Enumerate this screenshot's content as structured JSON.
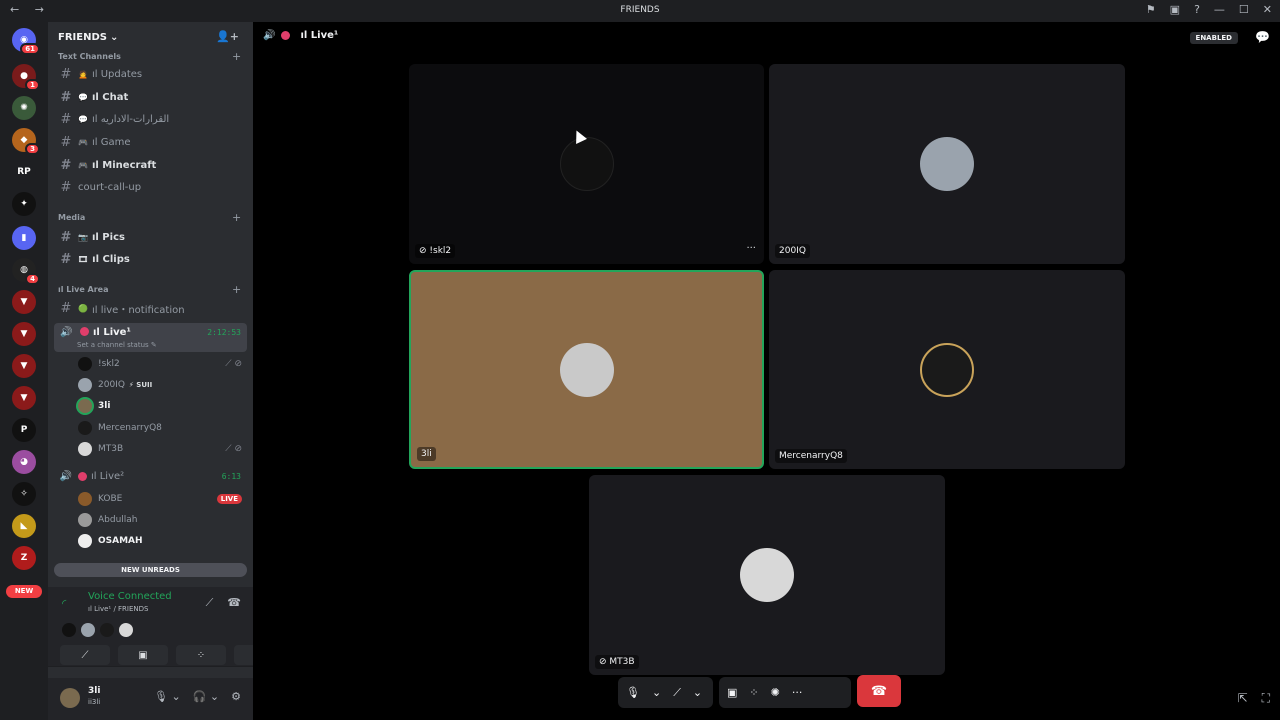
{
  "window": {
    "title": "FRIENDS",
    "nav": "← →",
    "icons": [
      "⚑",
      "▣",
      "?",
      "—",
      "☐",
      "✕"
    ]
  },
  "servers": [
    {
      "glyph": "◉",
      "badge": "61",
      "color": "#5865f2"
    },
    {
      "glyph": "●",
      "badge": "1",
      "color": "#7a1b1b"
    },
    {
      "glyph": "✺",
      "badge": "",
      "color": "#3a5a3a"
    },
    {
      "glyph": "◆",
      "badge": "3",
      "color": "#b5651d"
    },
    {
      "glyph": "RP",
      "badge": "",
      "color": "#1e1f22"
    },
    {
      "glyph": "✦",
      "badge": "",
      "color": "#111"
    },
    {
      "glyph": "▮",
      "badge": "",
      "color": "#5865f2"
    },
    {
      "glyph": "◍",
      "badge": "4",
      "color": "#222"
    },
    {
      "glyph": "▼",
      "badge": "",
      "color": "#8b1a1a"
    },
    {
      "glyph": "▼",
      "badge": "",
      "color": "#8b1a1a"
    },
    {
      "glyph": "▼",
      "badge": "",
      "color": "#8b1a1a"
    },
    {
      "glyph": "▼",
      "badge": "",
      "color": "#8b1a1a"
    },
    {
      "glyph": "P",
      "badge": "",
      "color": "#111"
    },
    {
      "glyph": "◕",
      "badge": "",
      "color": "#9b4da0"
    },
    {
      "glyph": "✧",
      "badge": "",
      "color": "#111"
    },
    {
      "glyph": "◣",
      "badge": "",
      "color": "#c49a1a"
    },
    {
      "glyph": "Z",
      "badge": "",
      "color": "#b01c1c"
    }
  ],
  "new_pill": "NEW",
  "guild": {
    "name": "FRIENDS",
    "chevron": "⌄",
    "invite_icon": "👤+"
  },
  "categories": {
    "text": "Text Channels",
    "media": "Media",
    "live": "ıl Live Area"
  },
  "channels": [
    {
      "emoji": "🙍",
      "name": "ıl Updates"
    },
    {
      "emoji": "💬",
      "name": "ıl Chat"
    },
    {
      "emoji": "💬",
      "name": "ıl القرارات-الاداريه"
    },
    {
      "emoji": "🎮",
      "name": "ıl Game"
    },
    {
      "emoji": "🎮",
      "name": "ıl Minecraft"
    },
    {
      "emoji": "",
      "name": "court-call-up"
    }
  ],
  "media_channels": [
    {
      "emoji": "📷",
      "name": "ıl Pics"
    },
    {
      "emoji": "🎞",
      "name": "ıl Clips"
    }
  ],
  "live_notification": {
    "emoji": "🟢",
    "name": "ıl live・notification"
  },
  "voice1": {
    "name": "ıl Live¹",
    "timer": "2:12:53",
    "status": "Set a channel status ✎",
    "users": [
      {
        "name": "!skl2",
        "icons": "⟋ ⊘"
      },
      {
        "name": "200IQ",
        "tag": "⚡ SUII",
        "icons": ""
      },
      {
        "name": "3li",
        "icons": ""
      },
      {
        "name": "MercenarryQ8",
        "icons": ""
      },
      {
        "name": "MT3B",
        "icons": "⟋ ⊘"
      }
    ]
  },
  "voice2": {
    "name": "ıl Live²",
    "timer": "6:13",
    "users": [
      {
        "name": "KOBE",
        "live": "LIVE"
      },
      {
        "name": "Abdullah",
        "live": ""
      },
      {
        "name": "OSAMAH",
        "live": ""
      }
    ]
  },
  "new_unreads": "NEW UNREADS",
  "voice_panel": {
    "title": "Voice Connected",
    "sub": "ıl Live¹ / FRIENDS",
    "signal_icon": "◜",
    "right_icons": [
      "⟋",
      "☎"
    ],
    "buttons": [
      "⟋",
      "▣",
      "⁘",
      "✺"
    ]
  },
  "user_panel": {
    "name": "3li",
    "sub": "ii3li",
    "icons": [
      "🎙 ⌄",
      "🎧 ⌄",
      "⚙"
    ]
  },
  "stage": {
    "channel": "ıl Live¹",
    "enabled": "ENABLED",
    "chat_icon": "💬",
    "tiles": [
      {
        "name": "!skl2",
        "muted": "⊘",
        "more": "···",
        "avatar_color": "#111"
      },
      {
        "name": "200IQ",
        "muted": "",
        "more": "",
        "avatar_color": "#9aa3ad"
      },
      {
        "name": "3li",
        "muted": "",
        "more": "",
        "avatar_color": "#c9c9c9"
      },
      {
        "name": "MercenarryQ8",
        "muted": "",
        "more": "",
        "avatar_color": "#1a1a1a"
      },
      {
        "name": "MT3B",
        "muted": "⊘",
        "more": "",
        "avatar_color": "#d8d8d8"
      }
    ],
    "controls": [
      "🎙",
      "⌄",
      "⟋",
      "⌄",
      "▣",
      "⁘",
      "✺",
      "···"
    ],
    "hangup": "☎",
    "corner": [
      "⇱",
      "⛶"
    ]
  }
}
